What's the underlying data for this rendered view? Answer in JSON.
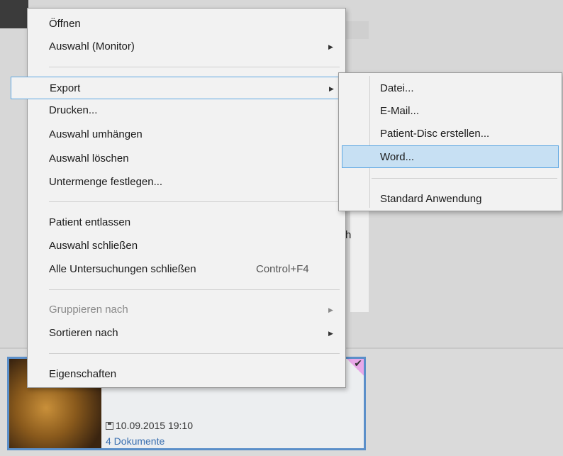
{
  "study": {
    "date": "10.09.2015 19:10",
    "documents": "4 Dokumente"
  },
  "background": {
    "partial_letter": "h"
  },
  "context_menu": {
    "items": [
      {
        "label": "Öffnen"
      },
      {
        "label": "Auswahl (Monitor)",
        "submenu": true
      },
      {
        "label": "Export",
        "submenu": true,
        "highlighted": true
      },
      {
        "label": "Drucken..."
      },
      {
        "label": "Auswahl umhängen"
      },
      {
        "label": "Auswahl löschen"
      },
      {
        "label": "Untermenge festlegen..."
      },
      {
        "label": "Patient entlassen"
      },
      {
        "label": "Auswahl schließen"
      },
      {
        "label": "Alle Untersuchungen schließen",
        "shortcut": "Control+F4"
      },
      {
        "label": "Gruppieren nach",
        "submenu": true,
        "disabled": true
      },
      {
        "label": "Sortieren nach",
        "submenu": true
      },
      {
        "label": "Eigenschaften"
      }
    ]
  },
  "export_submenu": {
    "items": [
      {
        "label": "Datei..."
      },
      {
        "label": "E-Mail..."
      },
      {
        "label": "Patient-Disc erstellen..."
      },
      {
        "label": "Word...",
        "selected": true
      },
      {
        "label": "Standard Anwendung"
      }
    ]
  },
  "colors": {
    "highlight_border": "#5fa8e3",
    "selected_fill": "#c7e0f3",
    "tile_border": "#5b8fc9"
  }
}
